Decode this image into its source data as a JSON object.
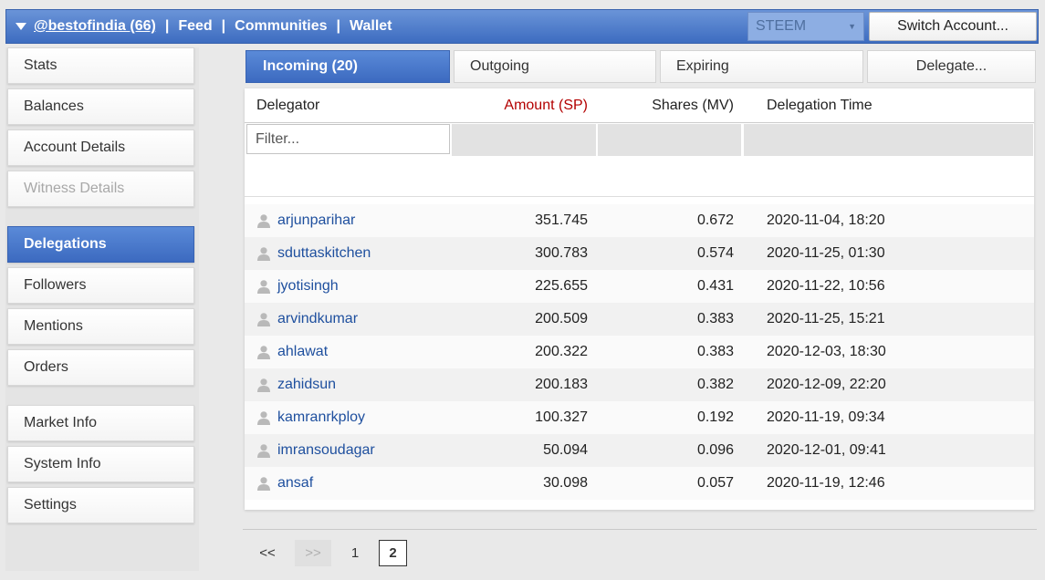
{
  "topbar": {
    "user_label": "@bestofindia (66)",
    "separator": "|",
    "feed_label": "Feed",
    "communities_label": "Communities",
    "wallet_label": "Wallet",
    "chain_select_value": "STEEM",
    "switch_account_label": "Switch Account..."
  },
  "sidebar": {
    "items": [
      {
        "label": "Stats",
        "state": "normal"
      },
      {
        "label": "Balances",
        "state": "normal"
      },
      {
        "label": "Account Details",
        "state": "normal"
      },
      {
        "label": "Witness Details",
        "state": "disabled"
      },
      {
        "label": "Delegations",
        "state": "active"
      },
      {
        "label": "Followers",
        "state": "normal"
      },
      {
        "label": "Mentions",
        "state": "normal"
      },
      {
        "label": "Orders",
        "state": "normal"
      },
      {
        "label": "Market Info",
        "state": "normal"
      },
      {
        "label": "System Info",
        "state": "normal"
      },
      {
        "label": "Settings",
        "state": "normal"
      }
    ]
  },
  "tabs": [
    {
      "label": "Incoming (20)",
      "active": true
    },
    {
      "label": "Outgoing",
      "active": false
    },
    {
      "label": "Expiring",
      "active": false
    },
    {
      "label": "Delegate...",
      "active": false
    }
  ],
  "table": {
    "headers": {
      "delegator": "Delegator",
      "amount": "Amount (SP)",
      "shares": "Shares (MV)",
      "time": "Delegation Time"
    },
    "filter_placeholder": "Filter...",
    "rows": [
      {
        "delegator": "arjunparihar",
        "amount": "351.745",
        "shares": "0.672",
        "time": "2020-11-04, 18:20"
      },
      {
        "delegator": "sduttaskitchen",
        "amount": "300.783",
        "shares": "0.574",
        "time": "2020-11-25, 01:30"
      },
      {
        "delegator": "jyotisingh",
        "amount": "225.655",
        "shares": "0.431",
        "time": "2020-11-22, 10:56"
      },
      {
        "delegator": "arvindkumar",
        "amount": "200.509",
        "shares": "0.383",
        "time": "2020-11-25, 15:21"
      },
      {
        "delegator": "ahlawat",
        "amount": "200.322",
        "shares": "0.383",
        "time": "2020-12-03, 18:30"
      },
      {
        "delegator": "zahidsun",
        "amount": "200.183",
        "shares": "0.382",
        "time": "2020-12-09, 22:20"
      },
      {
        "delegator": "kamranrkploy",
        "amount": "100.327",
        "shares": "0.192",
        "time": "2020-11-19, 09:34"
      },
      {
        "delegator": "imransoudagar",
        "amount": "50.094",
        "shares": "0.096",
        "time": "2020-12-01, 09:41"
      },
      {
        "delegator": "ansaf",
        "amount": "30.098",
        "shares": "0.057",
        "time": "2020-11-19, 12:46"
      }
    ]
  },
  "pagination": {
    "first_label": "<<",
    "next_label": ">>",
    "pages": [
      "1",
      "2"
    ],
    "current_page": "2"
  },
  "colors": {
    "accent": "#4a7bd0",
    "amount_header": "#b30000",
    "link": "#1e4f9e"
  },
  "icons": {
    "topbar_menu": "caret-down-icon",
    "row_user": "user-icon"
  }
}
